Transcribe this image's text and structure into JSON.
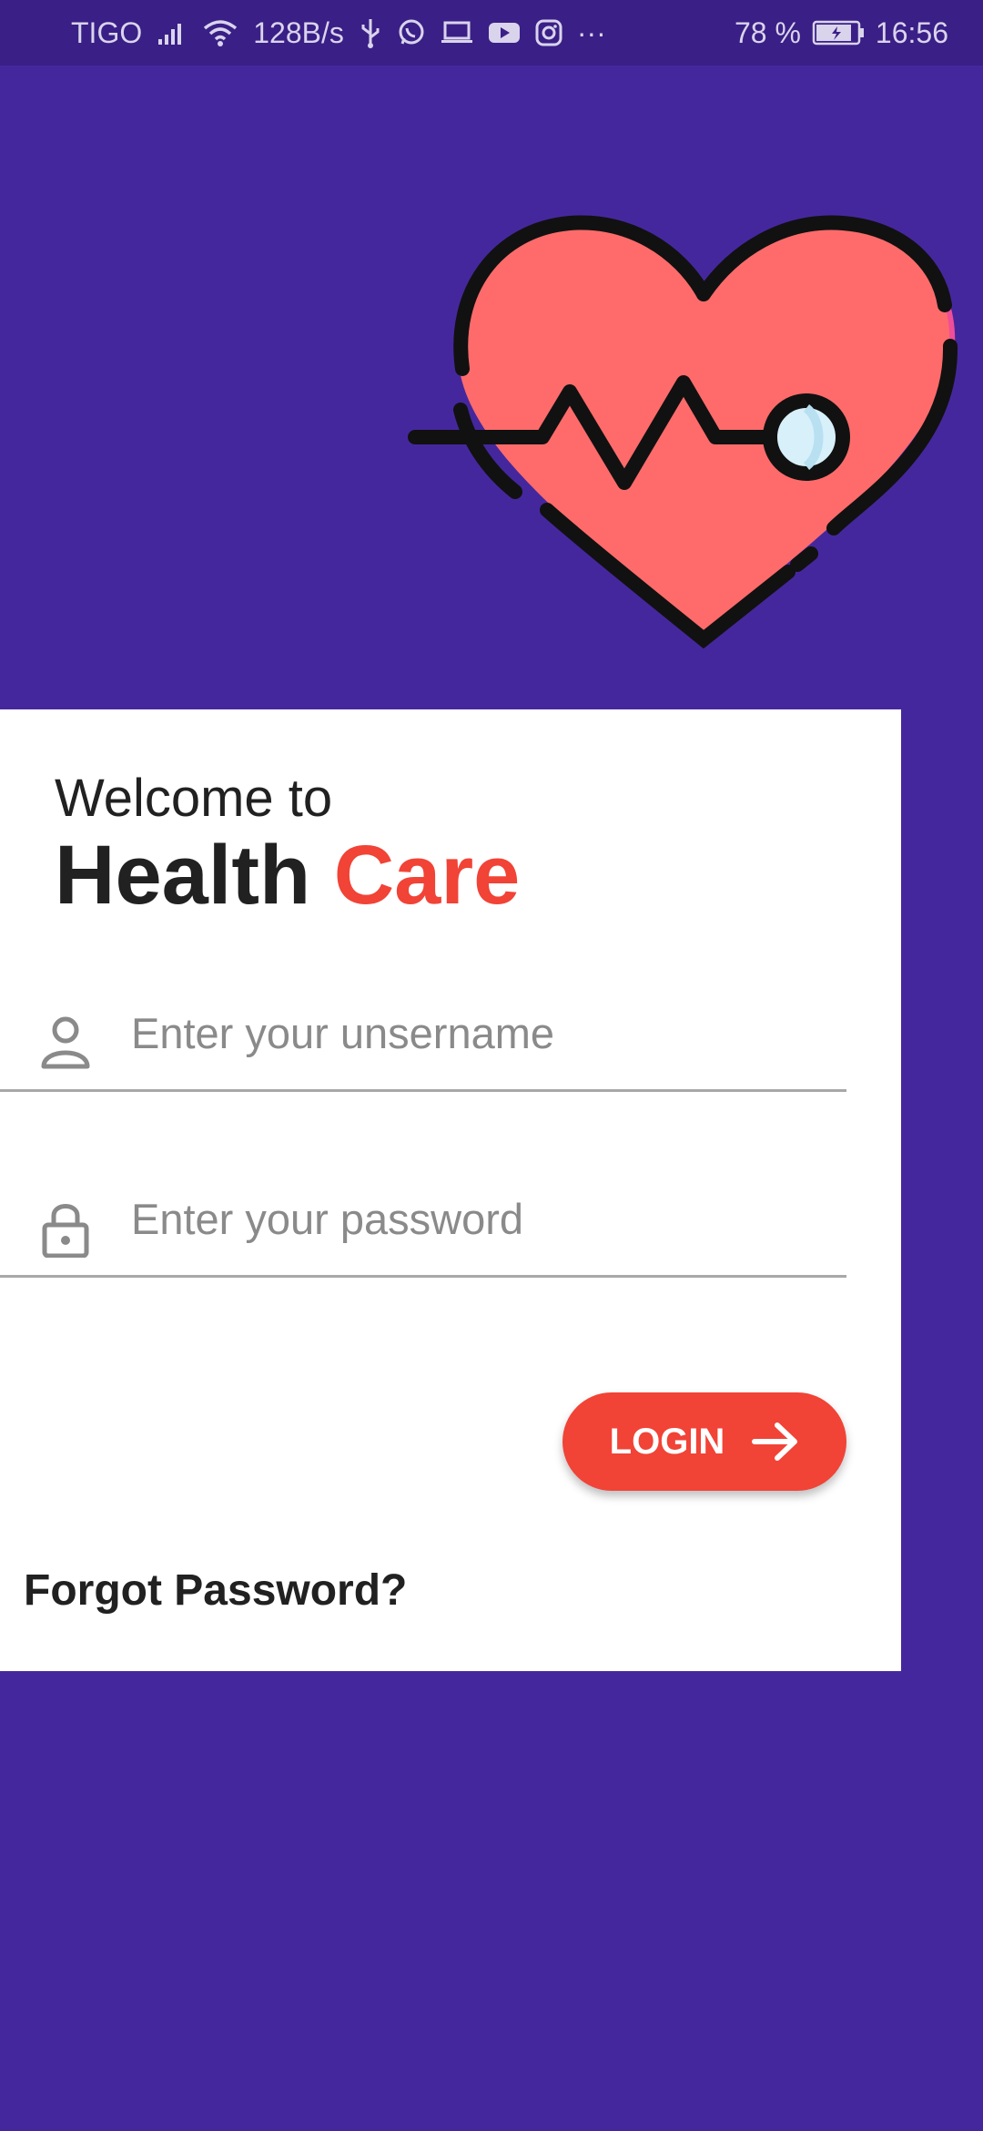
{
  "status_bar": {
    "carrier": "TIGO",
    "net_speed": "128B/s",
    "more": "···",
    "battery": "78 %",
    "time": "16:56"
  },
  "card": {
    "welcome": "Welcome to",
    "brand_main": "Health",
    "brand_accent": "Care"
  },
  "form": {
    "username_placeholder": "Enter your unsername",
    "password_placeholder": "Enter your password",
    "login_label": "LOGIN",
    "forgot_label": "Forgot Password?"
  },
  "colors": {
    "background": "#45279d",
    "accent": "#f14336",
    "heart": "#ff6b6b",
    "heart_shadow": "#f04e98"
  },
  "icons": [
    "signal-icon",
    "wifi-icon",
    "usb-icon",
    "whatsapp-icon",
    "laptop-icon",
    "youtube-icon",
    "instagram-icon",
    "battery-icon",
    "user-icon",
    "lock-icon",
    "arrow-right-icon"
  ]
}
